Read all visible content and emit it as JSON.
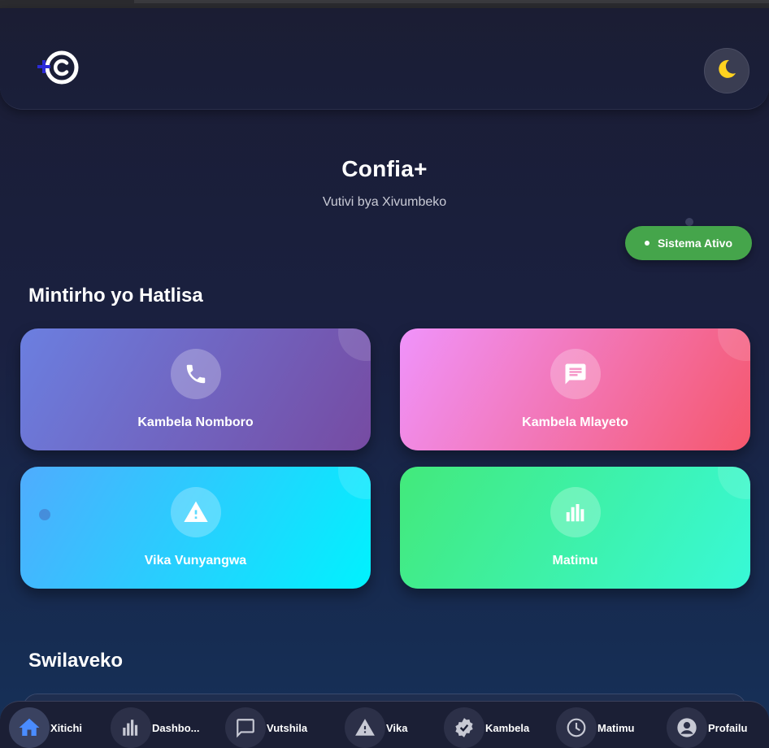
{
  "header": {
    "logo": "confia-plus-logo",
    "theme_toggle_icon": "moon-icon"
  },
  "hero": {
    "title": "Confia+",
    "subtitle": "Vutivi bya Xivumbeko"
  },
  "status": {
    "label": "Sistema Ativo",
    "color": "#45a54b"
  },
  "quick_actions": {
    "title": "Mintirho yo Hatlisa",
    "cards": [
      {
        "label": "Kambela Nomboro",
        "icon": "phone-icon",
        "gradient": [
          "#6b7fe0",
          "#764ba2"
        ]
      },
      {
        "label": "Kambela Mlayeto",
        "icon": "message-icon",
        "gradient": [
          "#f093fb",
          "#f5576c"
        ]
      },
      {
        "label": "Vika Vunyangwa",
        "icon": "warning-icon",
        "gradient": [
          "#4facfe",
          "#00f2fe"
        ]
      },
      {
        "label": "Matimu",
        "icon": "chart-icon",
        "gradient": [
          "#43e97b",
          "#38f9d7"
        ]
      }
    ]
  },
  "settings": {
    "title": "Swilaveko"
  },
  "bottom_nav": {
    "active": "Xitichi",
    "items": [
      {
        "label": "Xitichi",
        "icon": "home-icon"
      },
      {
        "label": "Dashbo...",
        "icon": "bar-chart-icon"
      },
      {
        "label": "Vutshila",
        "icon": "chat-icon"
      },
      {
        "label": "Vika",
        "icon": "warning-icon"
      },
      {
        "label": "Kambela",
        "icon": "verified-badge-icon"
      },
      {
        "label": "Matimu",
        "icon": "clock-icon"
      },
      {
        "label": "Profailu",
        "icon": "account-icon"
      }
    ]
  }
}
